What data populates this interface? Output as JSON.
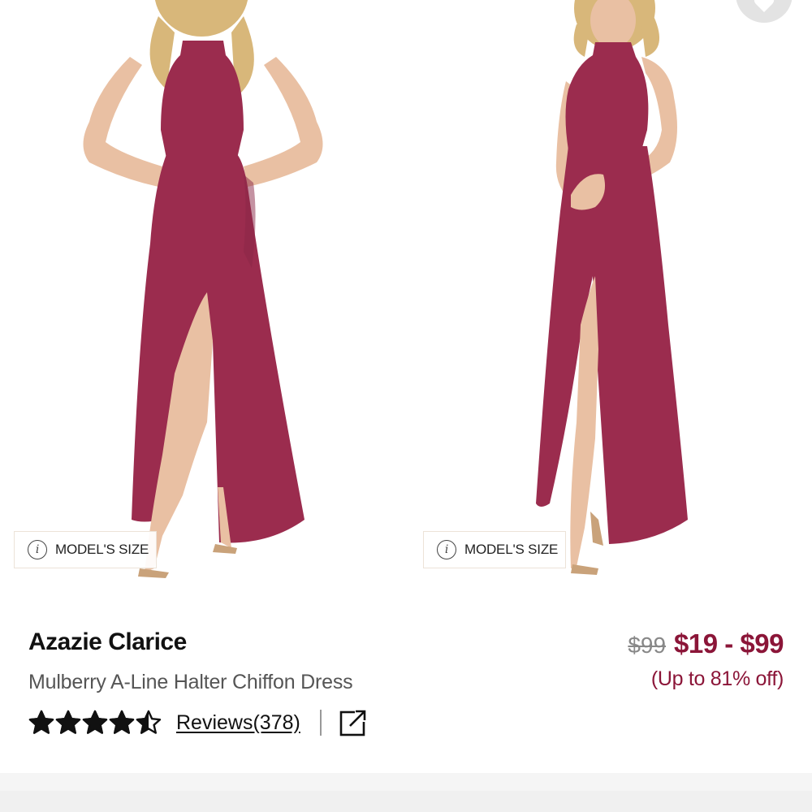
{
  "gallery": {
    "images": [
      {
        "alt": "front view",
        "badge_label": "MODEL'S SIZE"
      },
      {
        "alt": "side view",
        "badge_label": "MODEL'S SIZE"
      }
    ],
    "dress_color": "#9b2c4e",
    "skin_color": "#e9c0a3",
    "hair_color": "#d8b77a"
  },
  "favorite": {
    "icon": "heart-icon"
  },
  "product": {
    "brand": "Azazie Clarice",
    "name": "Mulberry A-Line Halter Chiffon Dress",
    "rating": 4.5,
    "rating_max": 5,
    "reviews_label": "Reviews(378)",
    "share_icon": "external-link-icon"
  },
  "price": {
    "original": "$99",
    "current": "$19 - $99",
    "discount": "(Up to 81% off)",
    "accent_color": "#8b1538"
  }
}
